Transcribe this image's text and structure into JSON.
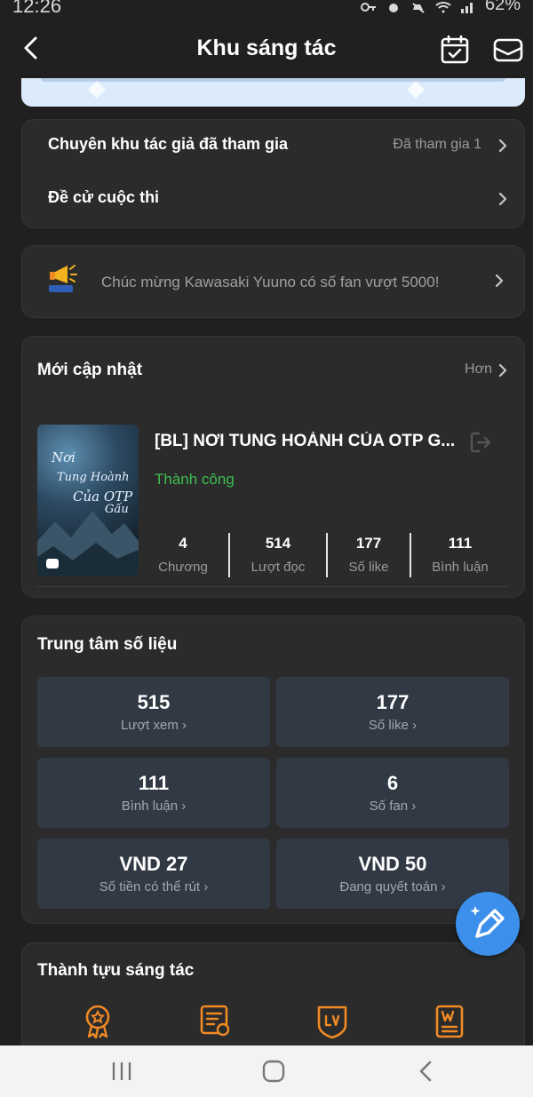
{
  "status_bar": {
    "time": "12:26",
    "battery": "62%"
  },
  "header": {
    "title": "Khu sáng tác"
  },
  "links": {
    "rows": [
      {
        "label": "Chuyên khu tác giả đã tham gia",
        "value": "Đã tham gia 1"
      },
      {
        "label": "Đề cử cuộc thi",
        "value": ""
      }
    ]
  },
  "notice": {
    "text": "Chúc mừng Kawasaki Yuuno có số fan vượt 5000!"
  },
  "recent": {
    "title": "Mới cập nhật",
    "more": "Hơn",
    "story": {
      "cover_text": [
        "Nơi",
        "Tung Hoành",
        "Của OTP",
        "Gấu"
      ],
      "title": "[BL] NƠI TUNG HOÀNH CỦA OTP G...",
      "status": "Thành công",
      "stats": [
        {
          "value": "4",
          "label": "Chương"
        },
        {
          "value": "514",
          "label": "Lượt đọc"
        },
        {
          "value": "177",
          "label": "Số like"
        },
        {
          "value": "111",
          "label": "Bình luận"
        }
      ]
    }
  },
  "data_center": {
    "title": "Trung tâm số liệu",
    "tiles": [
      {
        "value": "515",
        "label": "Lượt xem"
      },
      {
        "value": "177",
        "label": "Số like"
      },
      {
        "value": "111",
        "label": "Bình luận"
      },
      {
        "value": "6",
        "label": "Số fan"
      },
      {
        "value": "VND 27",
        "label": "Số tiền có thể rút"
      },
      {
        "value": "VND 50",
        "label": "Đang quyết toán"
      }
    ]
  },
  "achievements": {
    "title": "Thành tựu sáng tác",
    "icons": [
      "medal-icon",
      "certificate-icon",
      "level-badge-icon",
      "writer-badge-icon"
    ]
  },
  "colors": {
    "accent_orange": "#f08a24",
    "success_green": "#3dbf4f",
    "fab_blue": "#3c8fea",
    "tile_bg": "#313a44"
  }
}
